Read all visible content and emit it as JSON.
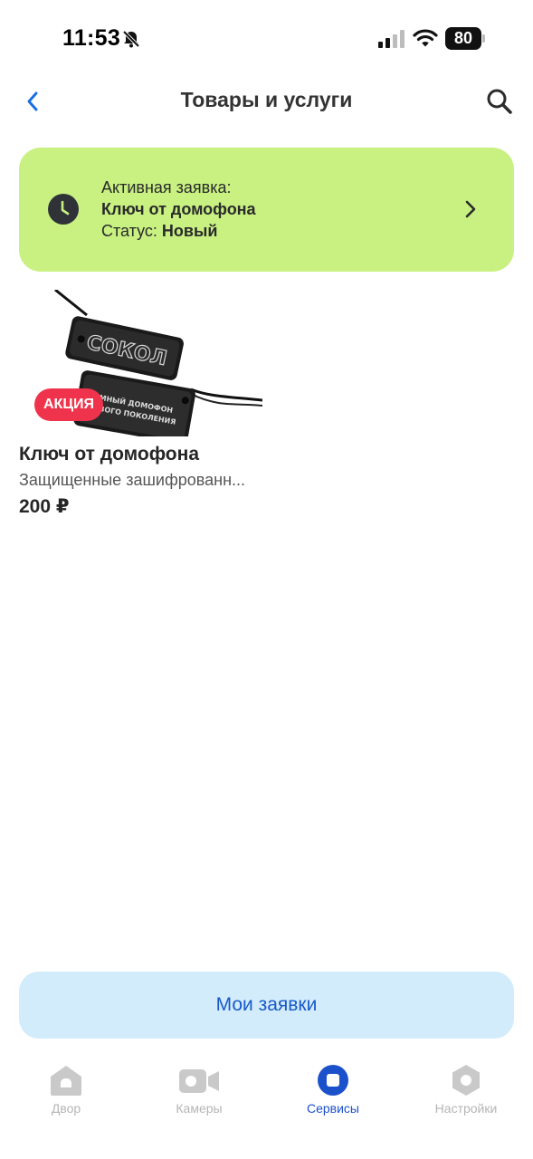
{
  "status_bar": {
    "time": "11:53",
    "battery": "80"
  },
  "nav": {
    "title": "Товары и услуги"
  },
  "active_request": {
    "label": "Активная заявка:",
    "title": "Ключ от домофона",
    "status_label": "Статус:",
    "status_value": "Новый"
  },
  "product": {
    "badge": "АКЦИЯ",
    "image_brand_text": "СОКОЛ",
    "image_tag_text": "УМНЫЙ ДОМОФОН НОВОГО ПОКОЛЕНИЯ",
    "title": "Ключ от домофона",
    "description": "Защищенные зашифрованн...",
    "price": "200 ₽"
  },
  "buttons": {
    "my_requests": "Мои заявки"
  },
  "tab_bar": {
    "tabs": [
      {
        "label": "Двор",
        "icon": "home-icon"
      },
      {
        "label": "Камеры",
        "icon": "camera-icon"
      },
      {
        "label": "Сервисы",
        "icon": "services-icon"
      },
      {
        "label": "Настройки",
        "icon": "settings-icon"
      }
    ],
    "active_index": 2
  },
  "colors": {
    "card_bg": "#c8f182",
    "accent_blue": "#1c51cc",
    "promo_red": "#f0334c",
    "button_bg": "#d2ecfb",
    "inactive_tab": "#b5b5b5"
  }
}
